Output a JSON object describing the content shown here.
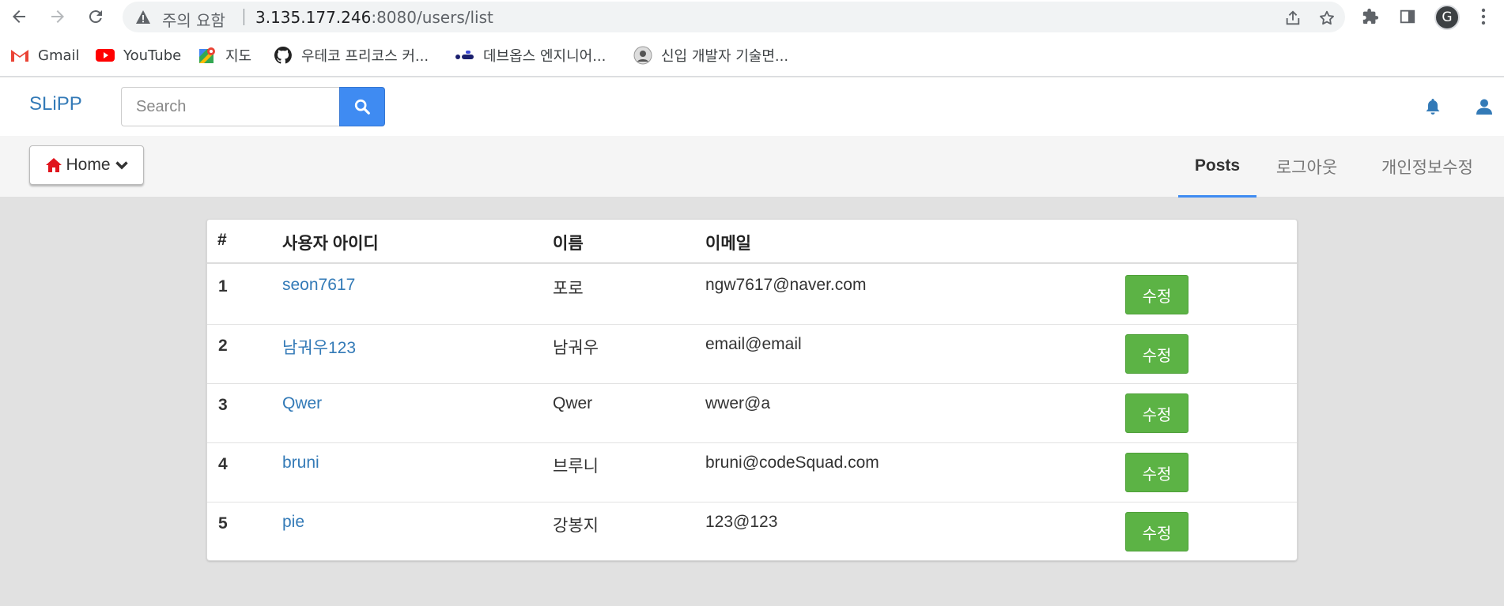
{
  "browser": {
    "security_label": "주의 요함",
    "url_host": "3.135.177.246",
    "url_path": ":8080/users/list",
    "profile_initial": "G"
  },
  "bookmarks": [
    {
      "label": "Gmail",
      "icon": "gmail-icon"
    },
    {
      "label": "YouTube",
      "icon": "youtube-icon"
    },
    {
      "label": "지도",
      "icon": "maps-icon"
    },
    {
      "label": "우테코 프리코스 커...",
      "icon": "github-icon"
    },
    {
      "label": "데브옵스 엔지니어...",
      "icon": "devops-icon"
    },
    {
      "label": "신입 개발자 기술면...",
      "icon": "avatar-icon"
    }
  ],
  "header": {
    "brand": "SLiPP",
    "search_placeholder": "Search"
  },
  "subnav": {
    "home_label": "Home",
    "tabs": [
      {
        "label": "Posts",
        "active": true
      },
      {
        "label": "로그아웃",
        "active": false
      },
      {
        "label": "개인정보수정",
        "active": false
      }
    ]
  },
  "table": {
    "columns": [
      "#",
      "사용자 아이디",
      "이름",
      "이메일"
    ],
    "edit_label": "수정",
    "rows": [
      {
        "num": "1",
        "user_id": "seon7617",
        "name": "포로",
        "email": "ngw7617@naver.com"
      },
      {
        "num": "2",
        "user_id": "남궈우123",
        "name": "남궈우",
        "email": "email@email"
      },
      {
        "num": "3",
        "user_id": "Qwer",
        "name": "Qwer",
        "email": "wwer@a"
      },
      {
        "num": "4",
        "user_id": "bruni",
        "name": "브루니",
        "email": "bruni@codeSquad.com"
      },
      {
        "num": "5",
        "user_id": "pie",
        "name": "강봉지",
        "email": "123@123"
      }
    ]
  },
  "colors": {
    "brand_blue": "#337ab7",
    "search_button": "#3f8bf2",
    "edit_button": "#5cb345",
    "home_icon": "#e0141d"
  }
}
